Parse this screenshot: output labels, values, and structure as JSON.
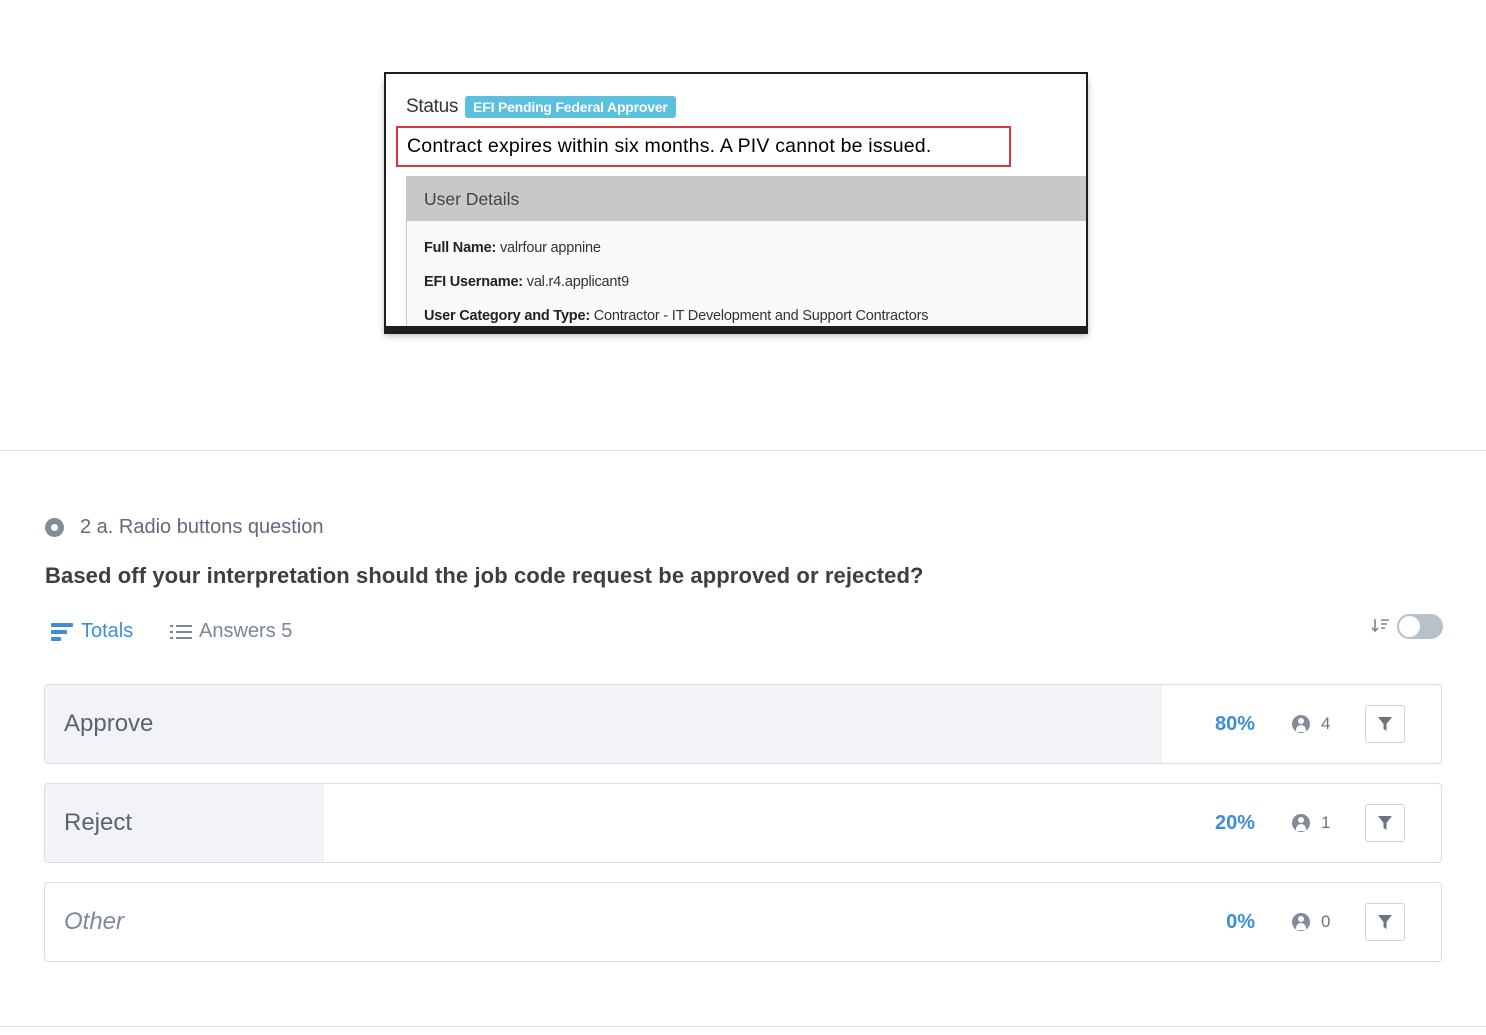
{
  "embedded_image": {
    "status_label": "Status",
    "status_badge": "EFI Pending Federal Approver",
    "warning_text": "Contract expires within six months. A PIV cannot be issued.",
    "panel_title": "User Details",
    "fields": [
      {
        "label": "Full Name:",
        "value": " valrfour appnine"
      },
      {
        "label": "EFI Username:",
        "value": " val.r4.applicant9"
      },
      {
        "label": "User Category and Type:",
        "value": " Contractor - IT Development and Support Contractors"
      }
    ]
  },
  "question": {
    "type_label": "2 a. Radio buttons question",
    "title": "Based off your interpretation should the job code request be approved or rejected?"
  },
  "tabs": {
    "totals": "Totals",
    "answers": "Answers 5"
  },
  "colors": {
    "accent": "#3b8fd8",
    "bar_fill": "#f2f3f7",
    "warning_border": "#d9363e",
    "badge": "#5bc0de"
  },
  "sort_toggle_on": false,
  "answers": [
    {
      "label": "Approve",
      "percent_text": "80%",
      "fraction": 0.8,
      "count": "4"
    },
    {
      "label": "Reject",
      "percent_text": "20%",
      "fraction": 0.2,
      "count": "1"
    },
    {
      "label": "Other",
      "percent_text": "0%",
      "fraction": 0.0,
      "count": "0"
    }
  ]
}
